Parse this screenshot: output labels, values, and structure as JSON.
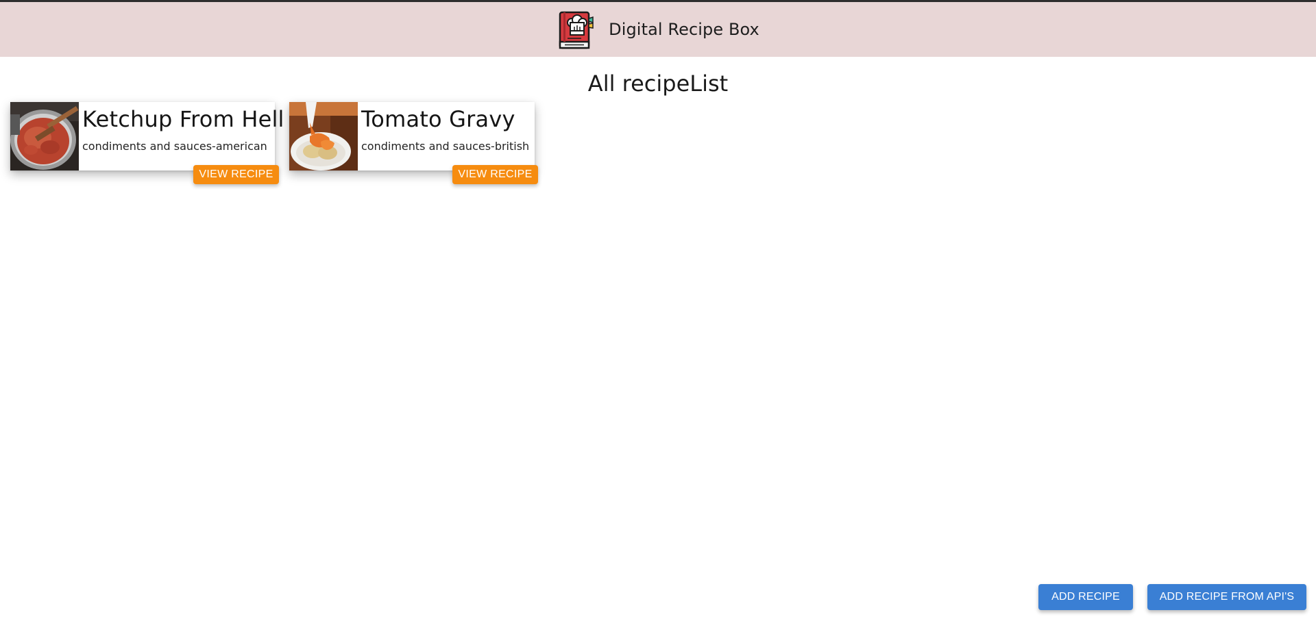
{
  "header": {
    "app_title": "Digital Recipe Box",
    "logo_icon": "recipe-book-chef-hat-icon",
    "background_color": "#e8d6d6"
  },
  "main": {
    "heading": "All recipeList",
    "recipes": [
      {
        "title": "Ketchup From Hell",
        "category": "condiments and sauces-american",
        "image_icon": "pot-of-sauce-photo",
        "button_label": "VIEW RECIPE"
      },
      {
        "title": "Tomato Gravy",
        "category": "condiments and sauces-british",
        "image_icon": "plated-gravy-photo",
        "button_label": "VIEW RECIPE"
      }
    ]
  },
  "actions": {
    "add_recipe_label": "ADD RECIPE",
    "add_recipe_api_label": "ADD RECIPE FROM API'S"
  },
  "colors": {
    "view_button": "#f68c10",
    "action_button": "#3a7fd4"
  }
}
